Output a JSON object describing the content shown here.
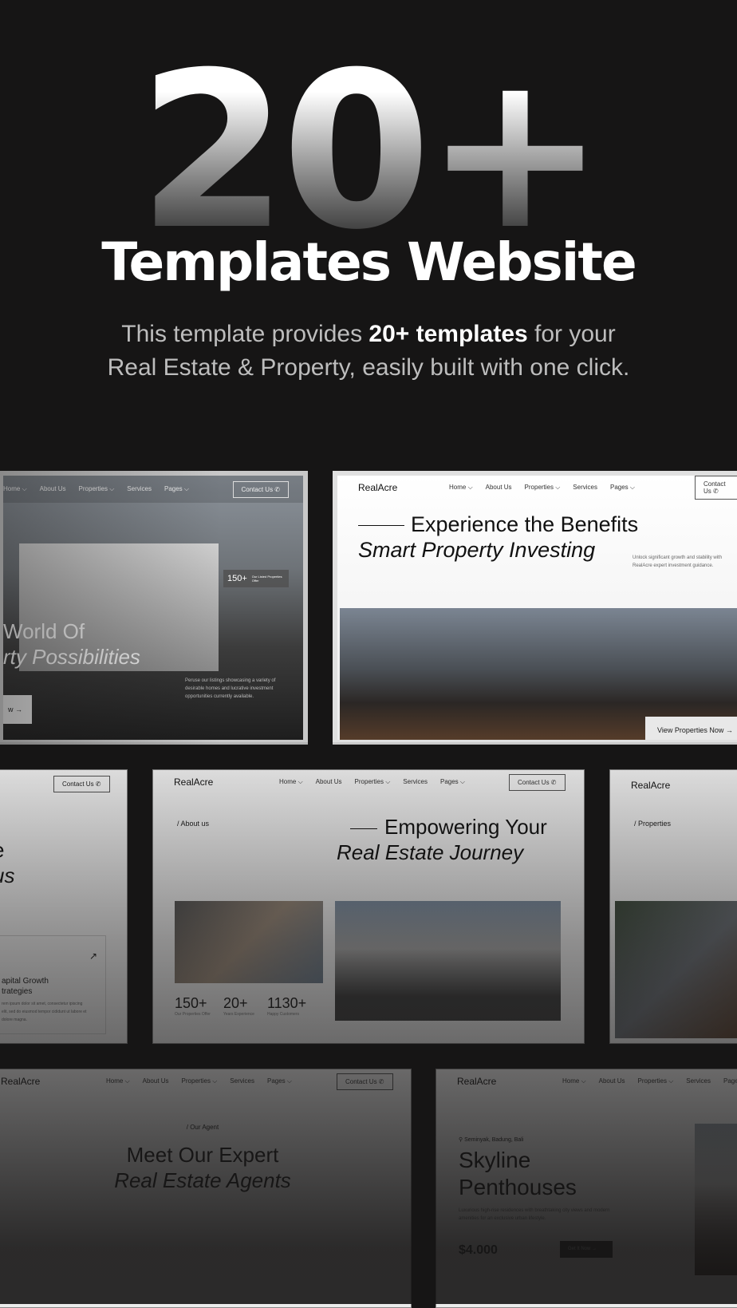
{
  "hero": {
    "big": "20+",
    "title": "Templates Website",
    "sub_pre": "This template provides ",
    "sub_bold": "20+ templates",
    "sub_post": " for your",
    "sub_line2": "Real Estate & Property, easily built with one click."
  },
  "nav": {
    "logo": "RealAcre",
    "home": "Home ⌵",
    "about": "About Us",
    "properties": "Properties ⌵",
    "services": "Services",
    "pages": "Pages ⌵",
    "contact": "Contact Us ✆"
  },
  "card1": {
    "stat": "150+",
    "stat_label": "Our Listed Properties Offer",
    "h1": "World Of",
    "h2": "rty Possibilities",
    "desc": "Peruse our listings showcasing a variety of desirable homes and lucrative investment opportunities currently available.",
    "button": "w →"
  },
  "card2": {
    "h1": "Experience the Benefits",
    "h2": "Smart Property Investing",
    "desc": "Unlock significant growth and stability with RealAcre expert investment guidance.",
    "button": "View Properties Now →"
  },
  "card3": {
    "h1": "e",
    "h2": "us",
    "feature_title": "apital Growth trategies",
    "feature_desc": "rem ipsum dolor sit amet, consectetur ipiscing elit, sed do eiusmod tempor cididunt ut labore et dolore magna."
  },
  "card4": {
    "label": "About us",
    "h1": "Empowering Your",
    "h2": "Real Estate Journey",
    "stats": [
      {
        "value": "150+",
        "label": "Our Properties Offer"
      },
      {
        "value": "20+",
        "label": "Years Experience"
      },
      {
        "value": "1130+",
        "label": "Happy Customers"
      }
    ]
  },
  "card5": {
    "label": "Properties"
  },
  "card6": {
    "label": "Our Agent",
    "h1": "Meet Our Expert",
    "h2": "Real Estate Agents"
  },
  "card7": {
    "location": "Seminyak, Badung, Bali",
    "h1": "Skyline",
    "h2": "Penthouses",
    "desc": "Luxurious high-rise residences with breathtaking city views and modern amenities for an exclusive urban lifestyle.",
    "price": "$4.000",
    "button": "Get It Now →"
  }
}
